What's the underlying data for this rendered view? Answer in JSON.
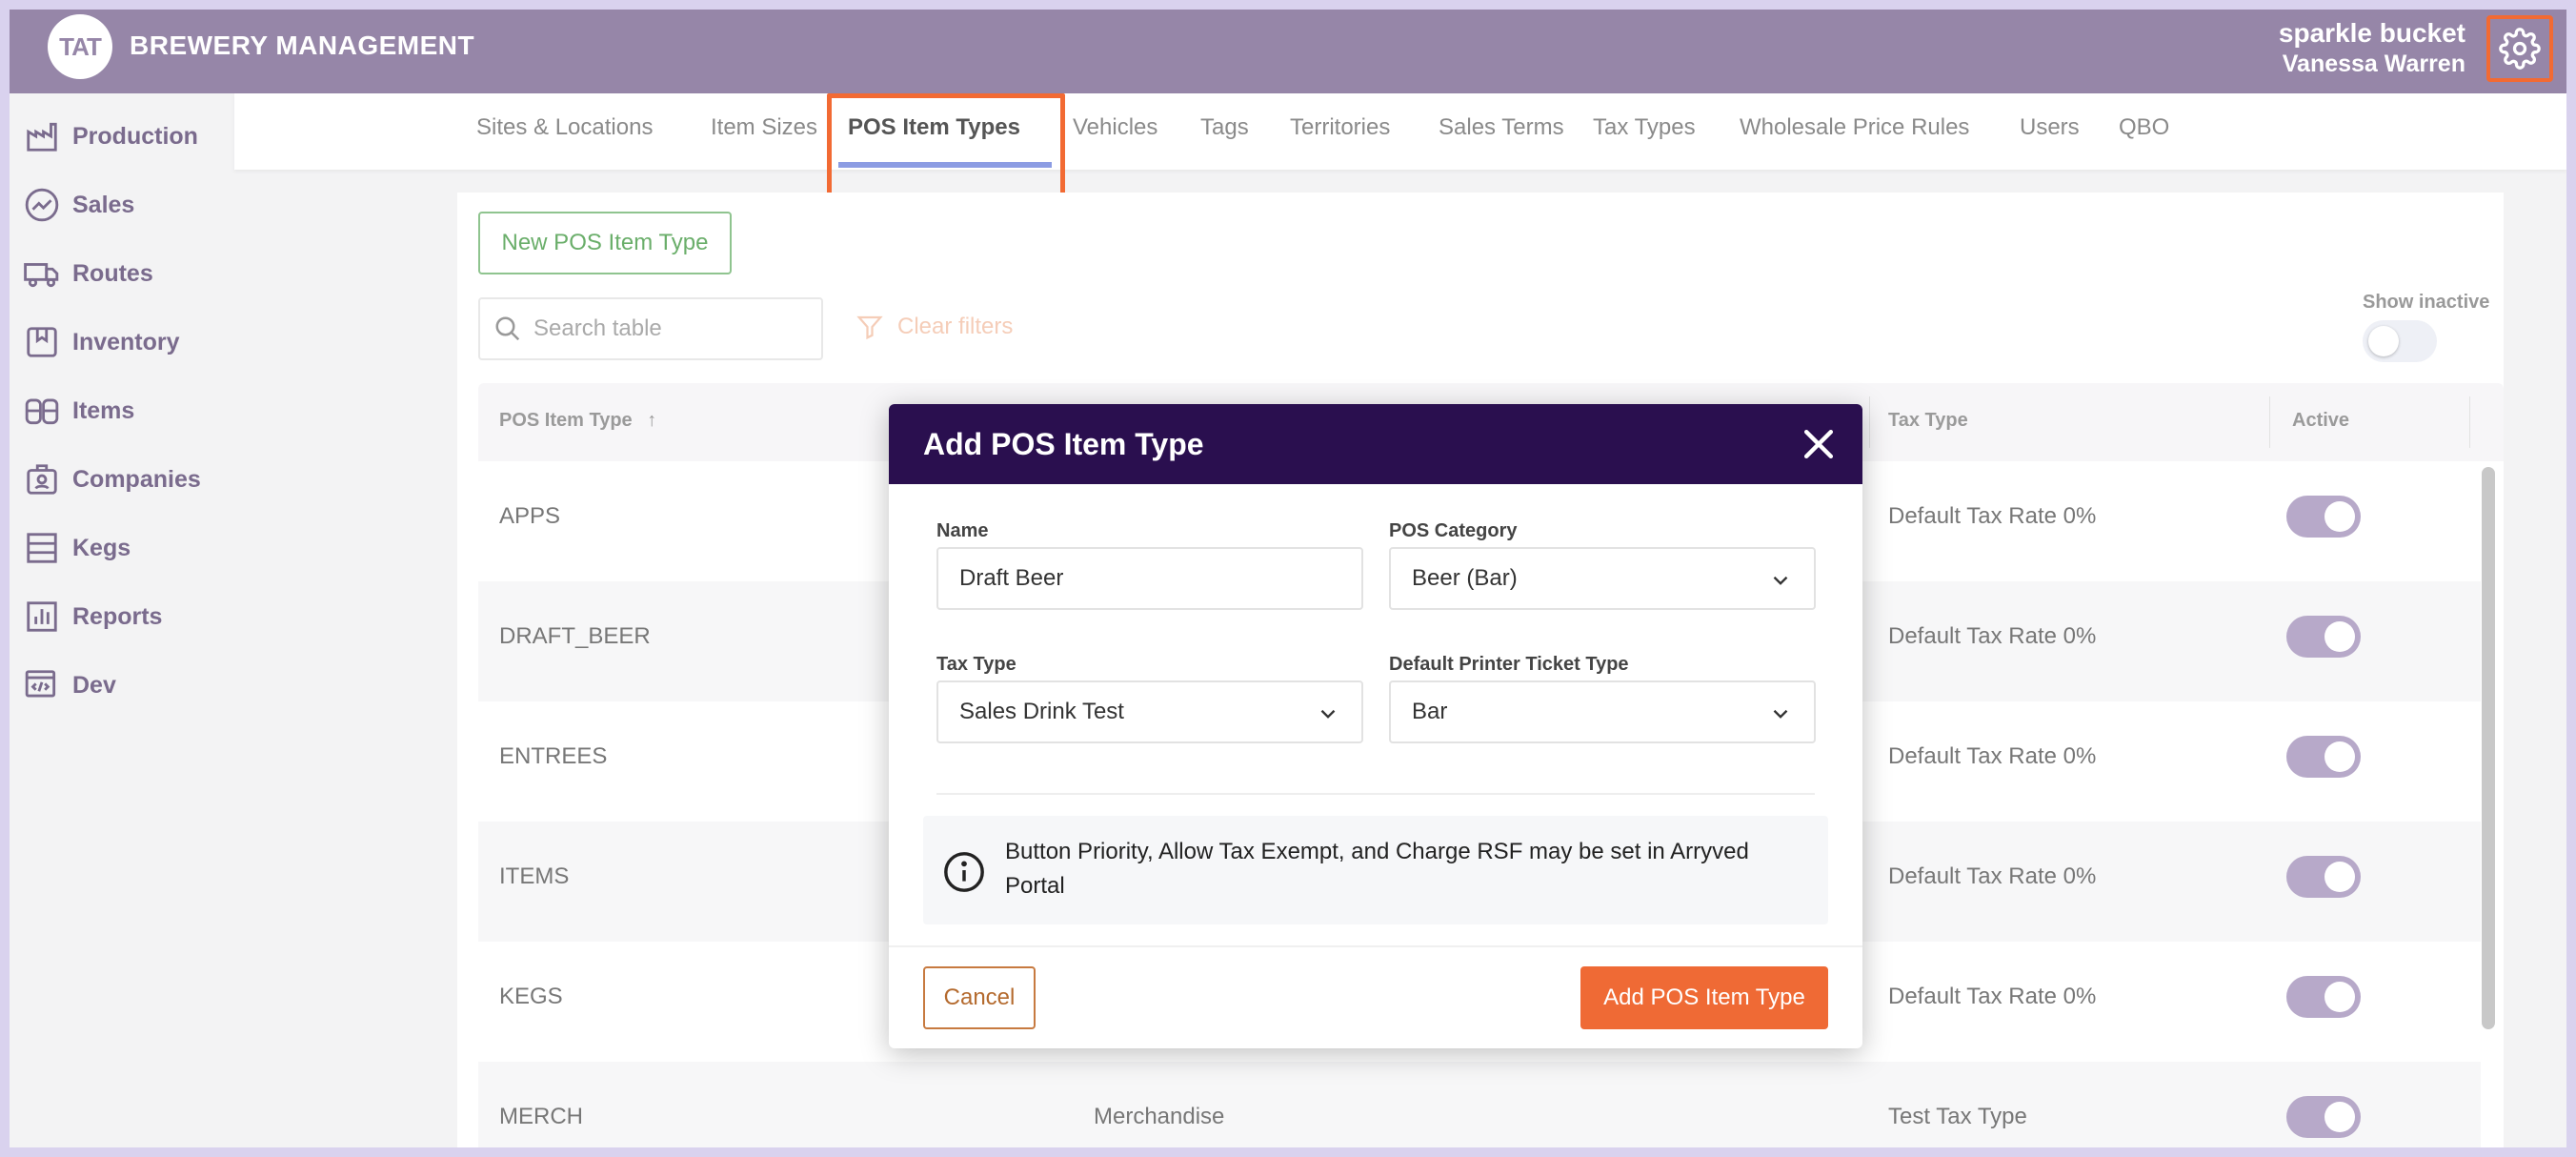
{
  "header": {
    "logo_text": "TAT",
    "brand": "BREWERY MANAGEMENT",
    "account": "sparkle bucket",
    "user": "Vanessa Warren"
  },
  "sidebar": {
    "items": [
      {
        "label": "Production",
        "icon": "factory-icon"
      },
      {
        "label": "Sales",
        "icon": "trend-icon"
      },
      {
        "label": "Routes",
        "icon": "truck-icon"
      },
      {
        "label": "Inventory",
        "icon": "inventory-icon"
      },
      {
        "label": "Items",
        "icon": "barrels-icon"
      },
      {
        "label": "Companies",
        "icon": "badge-icon"
      },
      {
        "label": "Kegs",
        "icon": "kegs-icon"
      },
      {
        "label": "Reports",
        "icon": "bar-chart-icon"
      },
      {
        "label": "Dev",
        "icon": "code-icon"
      }
    ]
  },
  "tabs": [
    "Sites & Locations",
    "Item Sizes",
    "POS Item Types",
    "Vehicles",
    "Tags",
    "Territories",
    "Sales Terms",
    "Tax Types",
    "Wholesale Price Rules",
    "Users",
    "QBO"
  ],
  "active_tab": "POS Item Types",
  "toolbar": {
    "new_button": "New POS Item Type",
    "search_placeholder": "Search table",
    "clear_filters": "Clear filters",
    "show_inactive": "Show inactive"
  },
  "table": {
    "headers": [
      "POS Item Type",
      "Tax Type",
      "Active"
    ],
    "sort_indicator": "↑",
    "rows": [
      {
        "type": "APPS",
        "category": "",
        "tax": "Default Tax Rate 0%",
        "active": true
      },
      {
        "type": "DRAFT_BEER",
        "category": "",
        "tax": "Default Tax Rate 0%",
        "active": true
      },
      {
        "type": "ENTREES",
        "category": "",
        "tax": "Default Tax Rate 0%",
        "active": true
      },
      {
        "type": "ITEMS",
        "category": "",
        "tax": "Default Tax Rate 0%",
        "active": true
      },
      {
        "type": "KEGS",
        "category": "",
        "tax": "Default Tax Rate 0%",
        "active": true
      },
      {
        "type": "MERCH",
        "category": "Merchandise",
        "tax": "Test Tax Type",
        "active": true
      }
    ]
  },
  "modal": {
    "title": "Add POS Item Type",
    "name_label": "Name",
    "name_value": "Draft Beer",
    "category_label": "POS Category",
    "category_value": "Beer (Bar)",
    "tax_label": "Tax Type",
    "tax_value": "Sales Drink Test",
    "printer_label": "Default Printer Ticket Type",
    "printer_value": "Bar",
    "info": "Button Priority, Allow Tax Exempt, and Charge RSF may be set in Arryved Portal",
    "cancel": "Cancel",
    "submit": "Add POS Item Type"
  },
  "colors": {
    "header": "#9686a8",
    "modal_header": "#2a0f4f",
    "accent": "#ef6a35",
    "highlight": "#f26a33",
    "tab_underline": "#8c9ce3",
    "toggle_on": "#b7a9c9"
  }
}
